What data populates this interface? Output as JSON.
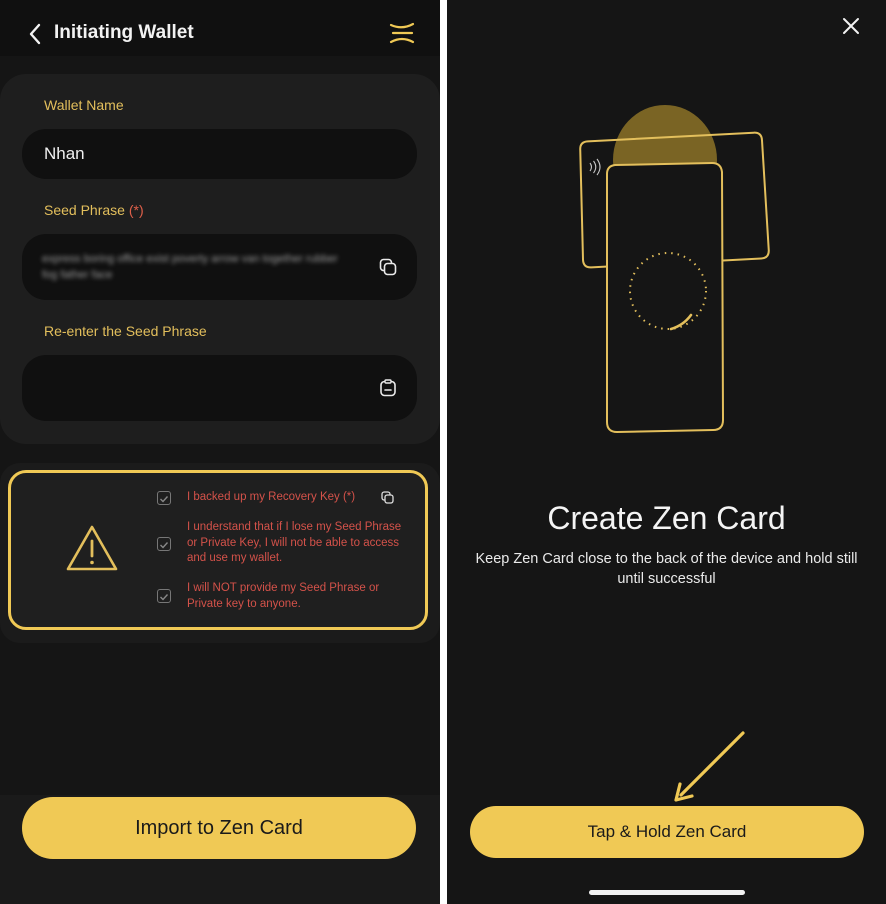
{
  "left": {
    "header": {
      "title": "Initiating Wallet",
      "back_icon": "chevron-left-icon",
      "logo_icon": "zen-logo-icon"
    },
    "form": {
      "wallet_name_label": "Wallet Name",
      "wallet_name_value": "Nhan",
      "seed_label": "Seed Phrase",
      "seed_required": "(*)",
      "seed_value": "express boring office exist poverty arrow van together rubber fog father face",
      "reenter_label": "Re-enter the Seed Phrase",
      "reenter_value": ""
    },
    "checklist": {
      "items": [
        {
          "text": "I backed up my Recovery Key (*)",
          "checked": true
        },
        {
          "text": "I understand that if I lose my Seed Phrase or Private Key, I will not be able to access and use my wallet.",
          "checked": true
        },
        {
          "text": "I will NOT provide my Seed Phrase or Private key to anyone.",
          "checked": true
        }
      ]
    },
    "import_button": "Import to Zen Card"
  },
  "right": {
    "title": "Create Zen Card",
    "subtitle": "Keep Zen Card close to the back of the device and hold still until successful",
    "tap_button": "Tap & Hold Zen Card"
  },
  "colors": {
    "accent": "#f0c955",
    "label": "#e3bf5c",
    "danger": "#d4524a",
    "background": "#151515"
  }
}
